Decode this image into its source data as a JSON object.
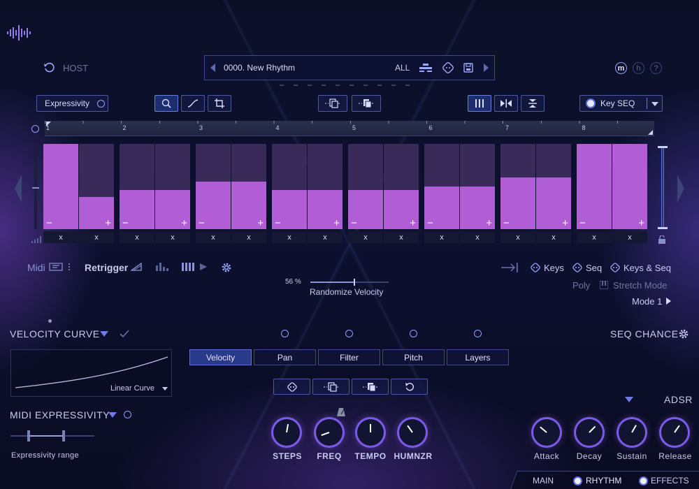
{
  "header": {
    "host_label": "HOST",
    "preset_name": "0000. New Rhythm",
    "filter_all": "ALL",
    "badges": [
      "m",
      "h",
      "?"
    ]
  },
  "toolbar": {
    "expressivity_label": "Expressivity",
    "key_seq_label": "Key SEQ"
  },
  "ruler": {
    "marks": [
      "1",
      "2",
      "3",
      "4",
      "5",
      "6",
      "7",
      "8"
    ]
  },
  "sequencer": {
    "columns": [
      {
        "value": 1.0,
        "x_label": "x"
      },
      {
        "value": 0.38,
        "x_label": "x"
      },
      {
        "value": 0.46,
        "x_label": "x"
      },
      {
        "value": 0.46,
        "x_label": "x"
      },
      {
        "value": 0.56,
        "x_label": "x"
      },
      {
        "value": 0.56,
        "x_label": "x"
      },
      {
        "value": 0.46,
        "x_label": "x"
      },
      {
        "value": 0.46,
        "x_label": "x"
      },
      {
        "value": 0.46,
        "x_label": "x"
      },
      {
        "value": 0.46,
        "x_label": "x"
      },
      {
        "value": 0.5,
        "x_label": "x"
      },
      {
        "value": 0.5,
        "x_label": "x"
      },
      {
        "value": 0.61,
        "x_label": "x"
      },
      {
        "value": 0.61,
        "x_label": "x"
      },
      {
        "value": 1.0,
        "x_label": "x"
      },
      {
        "value": 1.0,
        "x_label": "x"
      }
    ]
  },
  "midi_bar": {
    "midi_label": "Midi",
    "retrigger_label": "Retrigger",
    "randomize_keys": "Keys",
    "randomize_seq": "Seq",
    "randomize_keys_seq": "Keys & Seq",
    "poly_label": "Poly",
    "stretch_mode_label": "Stretch Mode",
    "mode_label": "Mode 1"
  },
  "randomize_velocity": {
    "percent": "56 %",
    "label": "Randomize Velocity",
    "value": 0.56
  },
  "velocity_curve": {
    "title": "VELOCITY CURVE",
    "curve_type": "Linear Curve"
  },
  "seq_chance": {
    "title": "SEQ CHANCE"
  },
  "tabs": [
    "Velocity",
    "Pan",
    "Filter",
    "Pitch",
    "Layers"
  ],
  "midi_expressivity": {
    "title": "MIDI EXPRESSIVITY",
    "range_label": "Expressivity range"
  },
  "knobs_left": [
    "STEPS",
    "FREQ",
    "TEMPO",
    "HUMNZR"
  ],
  "adsr": {
    "title": "ADSR",
    "knobs": [
      "Attack",
      "Decay",
      "Sustain",
      "Release"
    ]
  },
  "bottom_tabs": [
    "MAIN",
    "RHYTHM",
    "EFFECTS"
  ]
}
